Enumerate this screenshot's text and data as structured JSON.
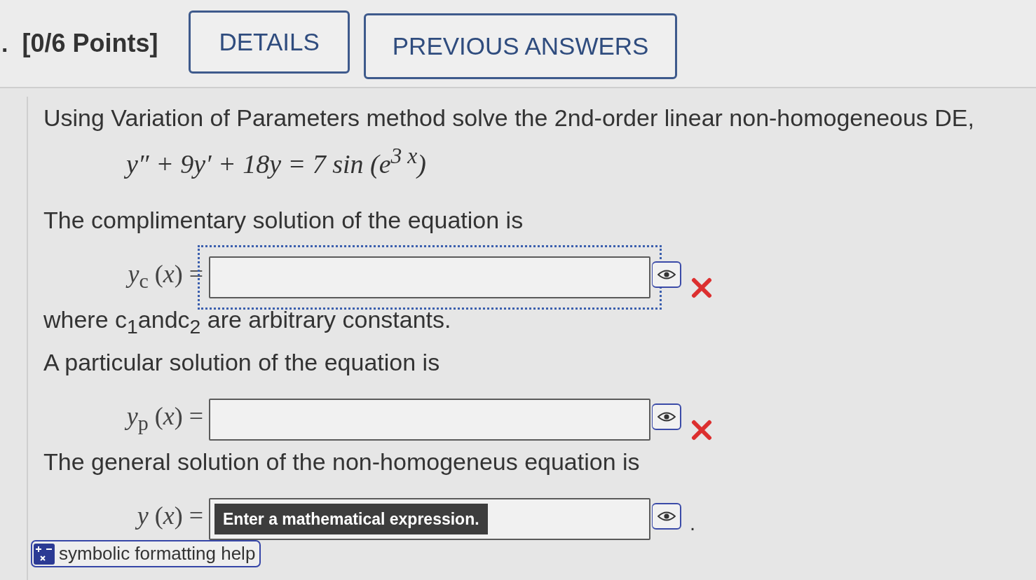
{
  "header": {
    "question_number": ".",
    "points": "[0/6 Points]",
    "buttons": [
      {
        "label": "DETAILS"
      },
      {
        "label": "PREVIOUS ANSWERS"
      }
    ]
  },
  "question": {
    "prompt": "Using Variation of Parameters method solve the 2nd-order linear non-homogeneous DE,",
    "equation": "y″ + 9y′ + 18y = 7 sin (e$^{3 x}$)",
    "blocks": [
      {
        "kind": "text",
        "text": "The complimentary solution of the equation is"
      },
      {
        "kind": "answer",
        "label": "*y*$_{c}$ (*x*) =",
        "focused": true,
        "incorrect": true
      },
      {
        "kind": "text",
        "text": "where c$_{1}$andc$_{2}$ are arbitrary constants."
      },
      {
        "kind": "text",
        "text": "A particular solution of the equation is"
      },
      {
        "kind": "answer",
        "label": "*y*$_{p}$ (*x*) =",
        "focused": false,
        "incorrect": true
      },
      {
        "kind": "text",
        "text": "The general solution of the non-homogeneus equation is"
      },
      {
        "kind": "answer",
        "label": "*y* (*x*) =",
        "focused": false,
        "incorrect": false,
        "tooltip": "Enter a mathematical expression.",
        "suffix": "."
      }
    ],
    "help_link": "symbolic formatting help"
  }
}
